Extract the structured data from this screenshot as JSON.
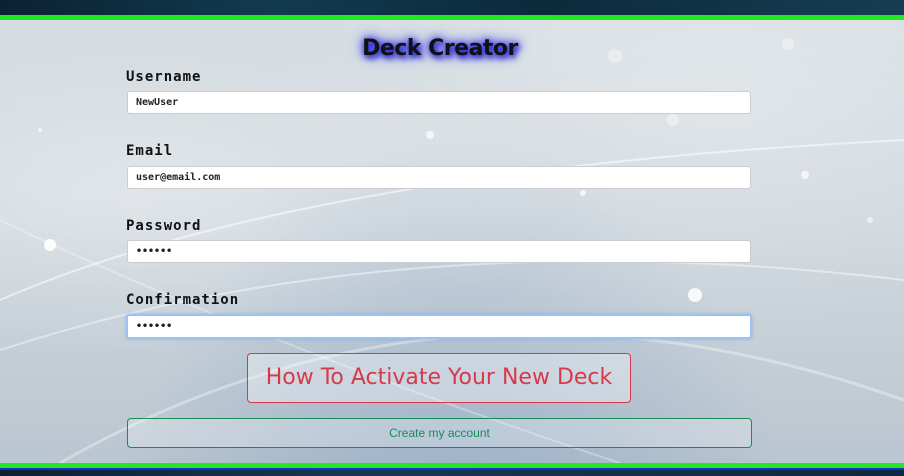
{
  "header": {
    "title": "Deck Creator"
  },
  "form": {
    "username": {
      "label": "Username",
      "value": "NewUser"
    },
    "email": {
      "label": "Email",
      "value": "user@email.com"
    },
    "password": {
      "label": "Password",
      "value": "••••••"
    },
    "confirmation": {
      "label": "Confirmation",
      "value": "••••••"
    }
  },
  "buttons": {
    "activate_label": "How To Activate Your New Deck",
    "create_label": "Create my account"
  },
  "colors": {
    "stripe_green": "#22e822",
    "stripe_blue": "#1b2bd6",
    "activate_red": "#d63a4a",
    "create_green": "#1a8a5a",
    "title_glow": "#2a2ae0"
  }
}
